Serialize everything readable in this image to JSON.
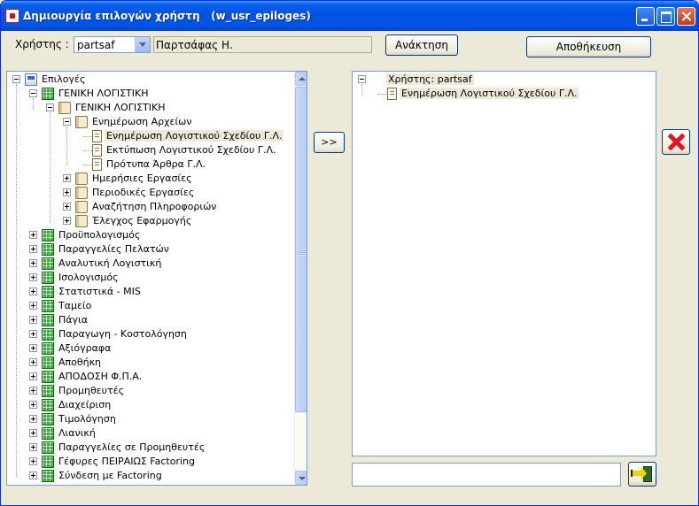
{
  "window": {
    "title": "Δημιουργία επιλογών χρήστη   (w_usr_epiloges)",
    "controls": [
      "minimize-icon",
      "maximize-icon",
      "close-icon"
    ]
  },
  "user_bar": {
    "label": "Χρήστης :",
    "selected_user": "partsaf",
    "full_name": "Παρτσάφας Η.",
    "retrieve_label": "Ανάκτηση",
    "save_label": "Αποθήκευση"
  },
  "left_tree": {
    "items": [
      {
        "label": "Επιλογές",
        "icon": "tree-root-icon",
        "expander": "minus"
      },
      {
        "label": "ΓΕΝΙΚΗ ΛΟΓΙΣΤΙΚΗ",
        "icon": "grid-icon",
        "expander": "minus"
      },
      {
        "label": "ΓΕΝΙΚΗ ΛΟΓΙΣΤΙΚΗ",
        "icon": "book-icon",
        "expander": "minus"
      },
      {
        "label": "Ενημέρωση Αρχείων",
        "icon": "book-icon",
        "expander": "minus"
      },
      {
        "label": "Ενημέρωση Λογιστικού Σχεδίου Γ.Λ.",
        "icon": "document-icon",
        "expander": "none",
        "selected": true
      },
      {
        "label": "Εκτύπωση Λογιστικού Σχεδίου Γ.Λ.",
        "icon": "document-icon",
        "expander": "none"
      },
      {
        "label": "Πρότυπα Άρθρα Γ.Λ.",
        "icon": "document-icon",
        "expander": "none"
      },
      {
        "label": "Ημερήσιες Εργασίες",
        "icon": "book-icon",
        "expander": "plus"
      },
      {
        "label": "Περιοδικές Εργασίες",
        "icon": "book-icon",
        "expander": "plus"
      },
      {
        "label": "Αναζήτηση Πληροφοριών",
        "icon": "book-icon",
        "expander": "plus"
      },
      {
        "label": "Έλεγχος Εφαρμογής",
        "icon": "book-icon",
        "expander": "plus"
      },
      {
        "label": "Προϋπολογισμός",
        "icon": "grid-icon",
        "expander": "plus"
      },
      {
        "label": "Παραγγελίες  Πελατών",
        "icon": "grid-icon",
        "expander": "plus"
      },
      {
        "label": "Αναλυτική Λογιστική",
        "icon": "grid-icon",
        "expander": "plus"
      },
      {
        "label": "Ισολογισμός",
        "icon": "grid-icon",
        "expander": "plus"
      },
      {
        "label": "Στατιστικά - MIS",
        "icon": "grid-icon",
        "expander": "plus"
      },
      {
        "label": "Ταμείο",
        "icon": "grid-icon",
        "expander": "plus"
      },
      {
        "label": "Πάγια",
        "icon": "grid-icon",
        "expander": "plus"
      },
      {
        "label": "Παραγωγη - Κοστολόγηση",
        "icon": "grid-icon",
        "expander": "plus"
      },
      {
        "label": "Αξιόγραφα",
        "icon": "grid-icon",
        "expander": "plus"
      },
      {
        "label": "Αποθήκη",
        "icon": "grid-icon",
        "expander": "plus"
      },
      {
        "label": "ΑΠΟΔΟΣΗ Φ.Π.Α.",
        "icon": "grid-icon",
        "expander": "plus"
      },
      {
        "label": "Προμηθευτές",
        "icon": "grid-icon",
        "expander": "plus"
      },
      {
        "label": "Διαχείριση",
        "icon": "grid-icon",
        "expander": "plus"
      },
      {
        "label": "Τιμολόγηση",
        "icon": "grid-icon",
        "expander": "plus"
      },
      {
        "label": "Λιανική",
        "icon": "grid-icon",
        "expander": "plus"
      },
      {
        "label": "Παραγγελίες σε Προμηθευτές",
        "icon": "grid-icon",
        "expander": "plus"
      },
      {
        "label": "Γέφυρες ΠΕΙΡΑΙΩΣ Factoring",
        "icon": "grid-icon",
        "expander": "plus"
      },
      {
        "label": "Σύνδεση με Factoring",
        "icon": "grid-icon",
        "expander": "plus"
      }
    ]
  },
  "move_button_label": ">>",
  "right_tree": {
    "items": [
      {
        "label": "Χρήστης: partsaf",
        "icon": "",
        "expander": "minus",
        "selected": true
      },
      {
        "label": "Ενημέρωση Λογιστικού Σχεδίου Γ.Λ.",
        "icon": "document-icon",
        "expander": "none",
        "selected": true
      }
    ]
  },
  "filter_input": {
    "value": "",
    "placeholder": ""
  },
  "colors": {
    "titlebar": "#0054e3",
    "window_bg": "#ece9d8",
    "delete_red": "#e0141e",
    "tree_green": "#33b033"
  }
}
